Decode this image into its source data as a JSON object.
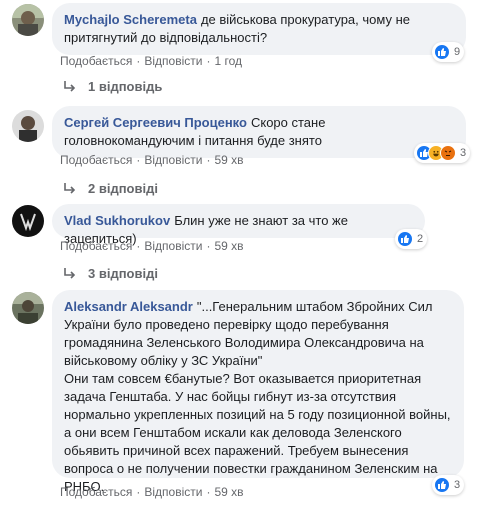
{
  "comments": [
    {
      "author": "Mychajlo Scheremeta",
      "text": "де військова прокуратура, чому не притягнутий до відповідальності?",
      "reactions": [
        "like-icon"
      ],
      "reaction_count": "9",
      "like_label": "Подобається",
      "reply_label": "Відповісти",
      "time": "1 год",
      "replies_label": "1 відповідь"
    },
    {
      "author": "Сергей Сергеевич Проценко",
      "text": "Скоро стане головнокомандуючим і питання буде знято",
      "reactions": [
        "like-icon",
        "haha-icon",
        "angry-icon"
      ],
      "reaction_count": "3",
      "like_label": "Подобається",
      "reply_label": "Відповісти",
      "time": "59 хв",
      "replies_label": "2 відповіді"
    },
    {
      "author": "Vlad Sukhorukov",
      "text": "Блин уже не знают за что же зацепиться)",
      "reactions": [
        "like-icon"
      ],
      "reaction_count": "2",
      "like_label": "Подобається",
      "reply_label": "Відповісти",
      "time": "59 хв",
      "replies_label": "3 відповіді"
    },
    {
      "author": "Aleksandr Aleksandr",
      "text": "\"...Генеральним штабом Збройних Сил України було проведено перевірку щодо перебування громадянина Зеленського Володимира Олександровича на військовому обліку у ЗС України\"\nОни там совсем €банутые? Вот оказывается приоритетная задача Генштаба. У нас бойцы гибнут из-за отсутствия нормально укрепленных позиций на 5 году позиционной войны, а они всем Генштабом искали как деловода Зеленского обьявить причиной всех паражений. Требуем вынесения вопроса о не получении повестки гражданином Зеленским на РНБО.",
      "reactions": [
        "like-icon"
      ],
      "reaction_count": "3",
      "like_label": "Подобається",
      "reply_label": "Відповісти",
      "time": "59 хв",
      "replies_label": ""
    }
  ],
  "colors": {
    "bubble": "#f0f2f5",
    "author": "#385898",
    "meta": "#65676b",
    "like": "#1877f2"
  }
}
